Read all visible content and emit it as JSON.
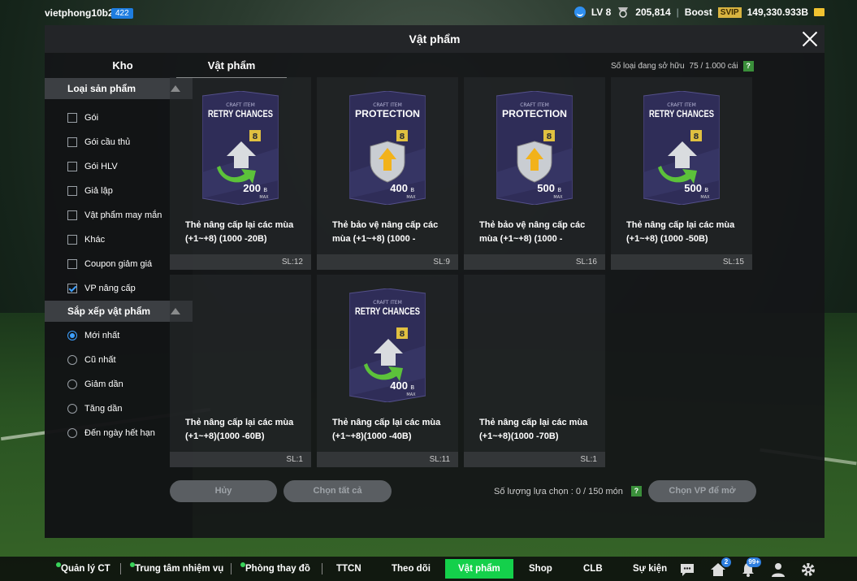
{
  "topbar": {
    "username": "vietphong10b2",
    "user_id_badge": "422",
    "level": "LV 8",
    "medal_count": "205,814",
    "boost_label": "Boost",
    "svip_label": "SVIP",
    "currency": "149,330.933B"
  },
  "modal": {
    "title": "Vật phẩm",
    "tabs": [
      "Kho",
      "Vật phẩm"
    ],
    "owned_label": "Số loại đang sở hữu",
    "owned_value": "75 / 1.000 cái",
    "help_glyph": "?"
  },
  "filters": {
    "category_header": "Loại sản phẩm",
    "categories": [
      {
        "label": "Gói",
        "checked": false
      },
      {
        "label": "Gói cầu thủ",
        "checked": false
      },
      {
        "label": "Gói HLV",
        "checked": false
      },
      {
        "label": "Giả lập",
        "checked": false
      },
      {
        "label": "Vật phẩm may mắn",
        "checked": false
      },
      {
        "label": "Khác",
        "checked": false
      },
      {
        "label": "Coupon giảm giá",
        "checked": false
      },
      {
        "label": "VP nâng cấp",
        "checked": true
      }
    ],
    "sort_header": "Sắp xếp vật phẩm",
    "sorts": [
      {
        "label": "Mới nhất",
        "checked": true
      },
      {
        "label": "Cũ nhất",
        "checked": false
      },
      {
        "label": "Giảm dần",
        "checked": false
      },
      {
        "label": "Tăng dần",
        "checked": false
      },
      {
        "label": "Đến ngày hết hạn",
        "checked": false
      }
    ]
  },
  "items": [
    {
      "card": "RETRY CHANCES",
      "value": "200",
      "name": "Thẻ nâng cấp lại các mùa (+1~+8) (1000 -20B)",
      "sl": "SL:12",
      "art": true,
      "kind": "retry"
    },
    {
      "card": "PROTECTION",
      "value": "400",
      "name": "Thẻ bảo vệ nâng cấp các mùa (+1~+8) (1000 -",
      "sl": "SL:9",
      "art": true,
      "kind": "protect"
    },
    {
      "card": "PROTECTION",
      "value": "500",
      "name": "Thẻ bảo vệ nâng cấp các mùa (+1~+8) (1000 -",
      "sl": "SL:16",
      "art": true,
      "kind": "protect"
    },
    {
      "card": "RETRY CHANCES",
      "value": "500",
      "name": "Thẻ nâng cấp lại các mùa (+1~+8) (1000 -50B)",
      "sl": "SL:15",
      "art": true,
      "kind": "retry"
    },
    {
      "card": "",
      "value": "",
      "name": "Thẻ nâng cấp lại các mùa (+1~+8)(1000 -60B)",
      "sl": "SL:1",
      "art": false,
      "kind": ""
    },
    {
      "card": "RETRY CHANCES",
      "value": "400",
      "name": "Thẻ nâng cấp lại các mùa (+1~+8)(1000 -40B)",
      "sl": "SL:11",
      "art": true,
      "kind": "retry"
    },
    {
      "card": "",
      "value": "",
      "name": "Thẻ nâng cấp lại các mùa (+1~+8)(1000 -70B)",
      "sl": "SL:1",
      "art": false,
      "kind": ""
    }
  ],
  "card_common": {
    "craft_label": "CRAFT ITEM",
    "level_badge": "8",
    "unit": "B",
    "max_label": "MAX"
  },
  "actions": {
    "cancel": "Hủy",
    "select_all": "Chọn tất cả",
    "select_count_label": "Số lượng lựa chọn : 0 / 150 món",
    "open": "Chọn VP để mở"
  },
  "bottom_nav": [
    {
      "label": "Quản lý CT",
      "dot": true
    },
    {
      "label": "Trung tâm nhiệm vụ",
      "dot": true
    },
    {
      "label": "Phòng thay đồ",
      "dot": true
    },
    {
      "label": "TTCN",
      "dot": false
    },
    {
      "label": "Theo dõi",
      "dot": false
    },
    {
      "label": "Vật phẩm",
      "dot": false,
      "active": true
    },
    {
      "label": "Shop",
      "dot": false
    },
    {
      "label": "CLB",
      "dot": false
    },
    {
      "label": "Sự kiện",
      "dot": false
    }
  ],
  "bottom_icons": {
    "home_badge": "2",
    "bell_badge": "99+"
  },
  "colors": {
    "accent_green": "#14d04b",
    "accent_blue": "#3ea0ff",
    "svip_gold": "#d8b340"
  }
}
